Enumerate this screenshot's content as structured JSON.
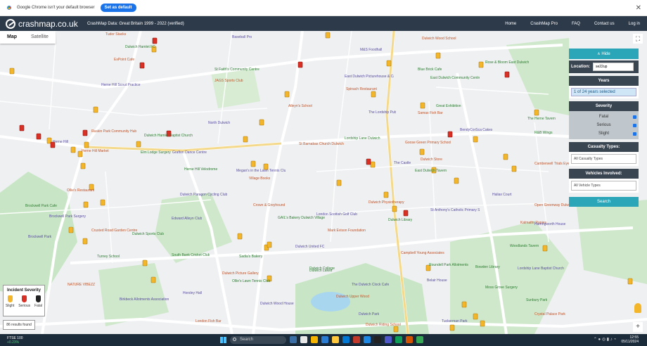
{
  "infobar": {
    "message": "Google Chrome isn't your default browser",
    "button": "Set as default",
    "close": "✕"
  },
  "header": {
    "logo": "crashmap.co.uk",
    "data_info": "CrashMap Data: Great Britain 1999 - 2022 (verified)",
    "nav": [
      "Home",
      "CrashMap Pro",
      "FAQ",
      "Contact us",
      "Log in"
    ]
  },
  "map": {
    "tabs": [
      "Map",
      "Satellite"
    ],
    "labels": [
      "Tudor Stacks",
      "Dulwich Hamlet FC",
      "Baseball Pro",
      "ExPoint Cafe",
      "St Faith's Community Centre",
      "M&S Foodhall",
      "Dulwich Wood School",
      "Rose & Bloom East Dulwich",
      "Herne Hill Scout Practice",
      "JAGS Sports Club",
      "Blue Brick Cafe",
      "East Dulwich Picturehouse & Cafe",
      "Spinach Restaurant",
      "East Dulwich Community Centre",
      "The Lordship Pub",
      "Samas Fish Bar",
      "Great Exhibition",
      "North Dulwich",
      "Alleyn's School",
      "Dulwich Hamlet Baptist Church",
      "BendyCorSca Cakes",
      "Goose Green Primary School",
      "The Herne Tavern",
      "Herne Hill",
      "Herne Hill Market",
      "Elm Lodge Surgery",
      "Grafton Dance Centre",
      "St Barnabas Church Dulwich",
      "Lordship Lane Dulwich",
      "The Castle",
      "Dulwich Store",
      "East Dulwich Tavern",
      "Megan's in the Lawn Tennis Club",
      "Village Books",
      "Herne Hill Velodrome",
      "Dulwich Paragon Cycling Club",
      "Ollie's Restaurant",
      "Brockwell Park Cafe",
      "Brockwell Park Surgery",
      "Crusted Road Garden Centre",
      "Dulwich Sports Club",
      "Edward Alleyn Club",
      "Crown & Greyhound",
      "GAIL's Bakery Dulwich Village",
      "London Scottish Golf Club",
      "Mark Evison Foundation",
      "Dulwich Library",
      "St Anthony's Catholic Primary School",
      "Dulwich Physiotherapy",
      "South Bank Cricket Club",
      "Dulwich United FC",
      "Dulwich Picture Gallery",
      "Sadia's Bakery",
      "The Dulwich Clock Cafe",
      "Campbell Young Associates",
      "Roundell Park Allotments",
      "Dulwich Wood House",
      "Dulwich Upper Wood",
      "Ollie's Lawn Tennis Club",
      "Belair House",
      "London Fish Bar",
      "Bowden Library",
      "Lordship Lane Baptist Church",
      "Kalmathr Rapies",
      "Woodlands Tavern",
      "Harringworth House",
      "Open Greenway Dulwich",
      "Sunbury Park",
      "Tuckerman Park",
      "Dulwich Riding School",
      "Dulwich Lakes",
      "Brockwell Park",
      "Crystal Palace Park",
      "Dulwich College",
      "Dulwich Park",
      "NATURE VIBEZZ",
      "Turney School",
      "Birkbeck Allotments Association",
      "Camberwell Trials Eye Unit",
      "Moss Grove Surgery",
      "Horsley Hall",
      "Ruskin Park Community Hub",
      "R&B Wings",
      "Haliax Court"
    ]
  },
  "panel": {
    "hide": "Hide",
    "location_label": "Location:",
    "location_value": "se22up",
    "years_title": "Years",
    "years_selected": "1 of 24 years selected",
    "severity_title": "Severity",
    "severity_options": [
      "Fatal",
      "Serious",
      "Slight"
    ],
    "casualty_title": "Casualty Types:",
    "casualty_value": "All Casualty Types",
    "vehicles_title": "Vehicles Involved:",
    "vehicles_value": "All Vehicle Types",
    "search": "Search"
  },
  "legend": {
    "title": "Incident Severity",
    "items": [
      {
        "label": "Slight",
        "color": "#f3b62b"
      },
      {
        "label": "Serious",
        "color": "#d93025"
      },
      {
        "label": "Fatal",
        "color": "#222222"
      }
    ],
    "results": "86 results found"
  },
  "taskbar": {
    "ftse_name": "FTSE 100",
    "ftse_change": "+0.23%",
    "search": "Search",
    "time": "12:55",
    "date": "05/11/2024"
  },
  "colors": {
    "header": "#2d3a4a",
    "accent": "#2ba6b8",
    "slight": "#f3b62b",
    "serious": "#d93025"
  }
}
